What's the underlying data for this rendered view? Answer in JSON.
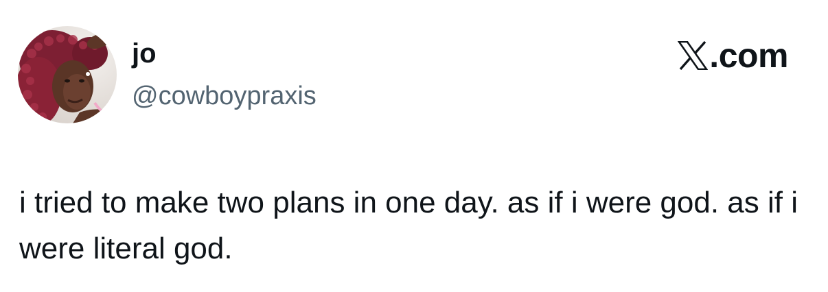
{
  "author": {
    "display_name": "jo",
    "handle": "@cowboypraxis",
    "avatar_icon": "profile-photo-avatar"
  },
  "brand": {
    "logo_icon": "x-logo-icon",
    "suffix": ".com"
  },
  "tweet": {
    "text": "i tried to make two plans in one day. as if i were god. as if i were literal god."
  },
  "colors": {
    "text_primary": "#0f1419",
    "text_secondary": "#536471",
    "background": "#ffffff"
  }
}
